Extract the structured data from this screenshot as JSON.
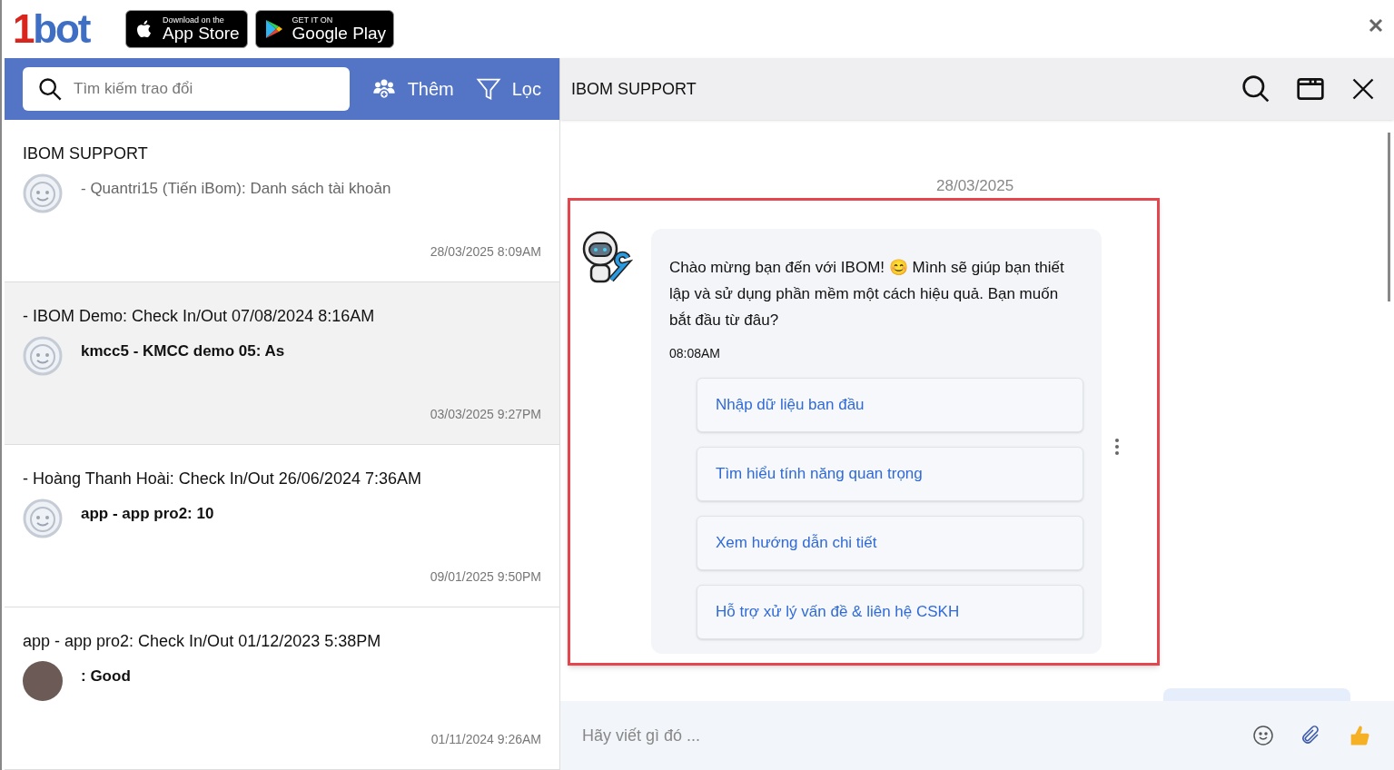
{
  "logo": {
    "mark": "1",
    "text": "bot"
  },
  "store_badges": [
    {
      "kind": "apple",
      "small": "Download on the",
      "big": "App Store"
    },
    {
      "kind": "google",
      "small": "GET IT ON",
      "big": "Google Play"
    }
  ],
  "sidebar": {
    "search": {
      "placeholder": "Tìm kiếm trao đổi"
    },
    "add_label": "Thêm",
    "filter_label": "Lọc",
    "conversations": [
      {
        "title": "IBOM SUPPORT",
        "preview": "- Quantri15 (Tiến iBom): Danh sách tài khoản",
        "bold_preview": false,
        "time": "28/03/2025 8:09AM",
        "kind": "default",
        "selected": false
      },
      {
        "title": "- IBOM Demo: Check In/Out 07/08/2024 8:16AM",
        "preview": "kmcc5 - KMCC demo 05: As",
        "bold_preview": true,
        "time": "03/03/2025 9:27PM",
        "kind": "default",
        "selected": true
      },
      {
        "title": "- Hoàng Thanh Hoài: Check In/Out 26/06/2024 7:36AM",
        "preview": "app - app pro2: 10",
        "bold_preview": true,
        "time": "09/01/2025 9:50PM",
        "kind": "default",
        "selected": false
      },
      {
        "title": "app - app pro2: Check In/Out 01/12/2023 5:38PM",
        "preview": ": Good",
        "bold_preview": true,
        "time": "01/11/2024 9:26AM",
        "kind": "photo",
        "selected": false
      }
    ]
  },
  "chat": {
    "title": "IBOM SUPPORT",
    "date": "28/03/2025",
    "message": {
      "text": "Chào mừng bạn đến với IBOM! 😊 Mình sẽ giúp bạn thiết lập và sử dụng phần mềm một cách hiệu quả. Bạn muốn bắt đầu từ đâu?",
      "time": "08:08AM",
      "options": [
        "Nhập dữ liệu ban đầu",
        "Tìm hiểu tính năng quan trọng",
        "Xem hướng dẫn chi tiết",
        "Hỗ trợ xử lý vấn đề & liên hệ CSKH"
      ]
    },
    "composer": {
      "placeholder": "Hãy viết gì đó ..."
    }
  }
}
